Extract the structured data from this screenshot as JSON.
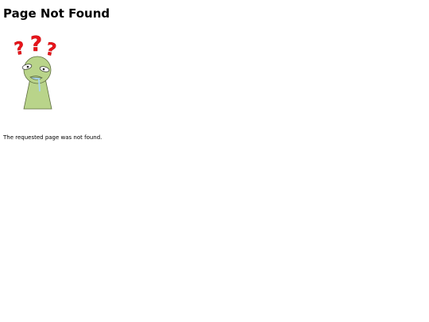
{
  "page": {
    "title": "Page Not Found",
    "message": "The requested page was not found."
  },
  "illustration": {
    "icon": "confused-figure-icon",
    "question_mark_icon": "question-mark-icon",
    "colors": {
      "question_marks": "#e8141b",
      "figure_fill": "#b9d48a",
      "outline": "#5c6b3e",
      "tear": "#a7d4ee"
    }
  }
}
